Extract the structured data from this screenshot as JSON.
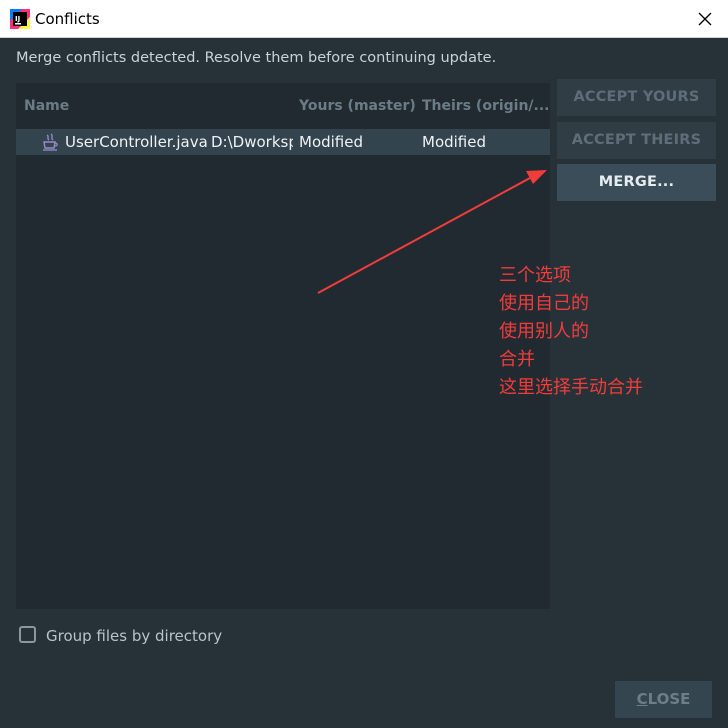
{
  "window": {
    "title": "Conflicts",
    "app_icon": "intellij-icon",
    "close_icon": "close-icon"
  },
  "message": "Merge conflicts detected. Resolve them before continuing update.",
  "table": {
    "columns": [
      "Name",
      "Yours (master)",
      "Theirs (origin/..."
    ],
    "rows": [
      {
        "icon": "java-file-icon",
        "name": "UserController.java",
        "path": "D:\\Dworksp",
        "yours": "Modified",
        "theirs": "Modified"
      }
    ]
  },
  "buttons": {
    "accept_yours": "ACCEPT YOURS",
    "accept_theirs": "ACCEPT THEIRS",
    "merge": "MERGE..."
  },
  "annotation": {
    "color": "#f23c3c",
    "lines": [
      "三个选项",
      "使用自己的",
      "使用别人的",
      "合并",
      "这里选择手动合并"
    ]
  },
  "group_checkbox": {
    "label": "Group files by directory",
    "checked": false
  },
  "close_button": {
    "label_first": "C",
    "label_rest": "LOSE"
  }
}
